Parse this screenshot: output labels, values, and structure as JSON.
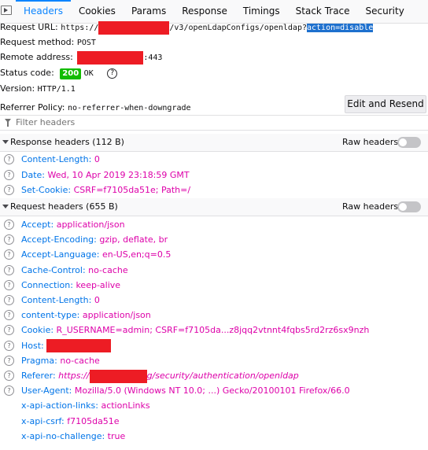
{
  "tabs": [
    "Headers",
    "Cookies",
    "Params",
    "Response",
    "Timings",
    "Stack Trace",
    "Security"
  ],
  "summary": {
    "request_url_label": "Request URL:",
    "request_url_prefix": "https://",
    "request_url_path": "/v3/openLdapConfigs/openldap?",
    "request_url_query": "action=disable",
    "request_method_label": "Request method:",
    "request_method": "POST",
    "remote_address_label": "Remote address:",
    "remote_address_port": ":443",
    "status_code_label": "Status code:",
    "status_code": "200",
    "status_text": "OK",
    "help": "?",
    "version_label": "Version:",
    "version": "HTTP/1.1",
    "referrer_policy_label": "Referrer Policy:",
    "referrer_policy": "no-referrer-when-downgrade",
    "edit_resend_label": "Edit and Resend"
  },
  "filter": {
    "placeholder": "Filter headers"
  },
  "response_section": {
    "title": "Response headers (112 B)",
    "raw_label": "Raw headers",
    "headers": [
      {
        "name": "Content-Length",
        "value": "0"
      },
      {
        "name": "Date",
        "value": "Wed, 10 Apr 2019 23:18:59 GMT"
      },
      {
        "name": "Set-Cookie",
        "value": "CSRF=f7105da51e; Path=/"
      }
    ]
  },
  "request_section": {
    "title": "Request headers (655 B)",
    "raw_label": "Raw headers",
    "headers": [
      {
        "name": "Accept",
        "value": "application/json"
      },
      {
        "name": "Accept-Encoding",
        "value": "gzip, deflate, br"
      },
      {
        "name": "Accept-Language",
        "value": "en-US,en;q=0.5"
      },
      {
        "name": "Cache-Control",
        "value": "no-cache"
      },
      {
        "name": "Connection",
        "value": "keep-alive"
      },
      {
        "name": "Content-Length",
        "value": "0"
      },
      {
        "name": "content-type",
        "value": "application/json"
      },
      {
        "name": "Cookie",
        "value": "R_USERNAME=admin; CSRF=f7105da...z8jqq2vtnnt4fqbs5rd2rz6sx9nzh"
      },
      {
        "name": "Host",
        "value": ""
      },
      {
        "name": "Pragma",
        "value": "no-cache"
      },
      {
        "name": "Referer",
        "value_prefix": "https://",
        "value_suffix": "g/security/authentication/openldap"
      },
      {
        "name": "User-Agent",
        "value": "Mozilla/5.0 (Windows NT 10.0; ...) Gecko/20100101 Firefox/66.0"
      },
      {
        "name": "x-api-action-links",
        "value": "actionLinks"
      },
      {
        "name": "x-api-csrf",
        "value": "f7105da51e"
      },
      {
        "name": "x-api-no-challenge",
        "value": "true"
      }
    ]
  },
  "icons": {
    "panel_toggle": "panel-toggle-icon",
    "filter": "filter-icon",
    "help": "question-circle-icon",
    "collapse": "twisty-down-icon"
  },
  "colors": {
    "accent": "#0a84ff",
    "header_name": "#0074e8",
    "header_value": "#dd00a9",
    "status_ok": "#12bc00",
    "redaction": "#ed1c24"
  }
}
